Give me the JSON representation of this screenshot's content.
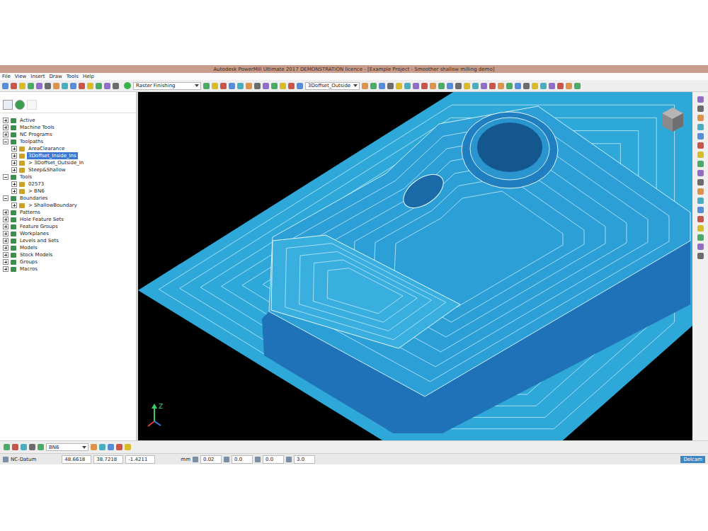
{
  "window": {
    "title": "Autodesk PowerMill Ultimate 2017 DEMONSTRATION licence - [Example Project - Smoother shallow milling demo]"
  },
  "menu": [
    "File",
    "View",
    "Insert",
    "Draw",
    "Tools",
    "Help"
  ],
  "toolbar": {
    "strategy": "Raster Finishing",
    "toolpath": "3Doffset_Outside"
  },
  "explorer": [
    {
      "label": "Active",
      "expanded": false,
      "selected": false,
      "children": []
    },
    {
      "label": "Machine Tools",
      "expanded": false,
      "selected": false,
      "children": []
    },
    {
      "label": "NC Programs",
      "expanded": false,
      "selected": false,
      "children": []
    },
    {
      "label": "Toolpaths",
      "expanded": true,
      "selected": false,
      "children": [
        {
          "label": "AreaClearance",
          "expanded": false,
          "selected": false,
          "children": []
        },
        {
          "label": "3Doffset_Inside_Ins",
          "expanded": false,
          "selected": true,
          "children": []
        },
        {
          "label": "> 3Doffset_Outside_In",
          "expanded": false,
          "selected": false,
          "children": []
        },
        {
          "label": "Steep&Shallow",
          "expanded": false,
          "selected": false,
          "children": []
        }
      ]
    },
    {
      "label": "Tools",
      "expanded": true,
      "selected": false,
      "children": [
        {
          "label": "02573",
          "expanded": false,
          "selected": false,
          "children": []
        },
        {
          "label": "> BN6",
          "expanded": false,
          "selected": false,
          "children": []
        }
      ]
    },
    {
      "label": "Boundaries",
      "expanded": true,
      "selected": false,
      "children": [
        {
          "label": "> ShallowBoundary",
          "expanded": false,
          "selected": false,
          "children": []
        }
      ]
    },
    {
      "label": "Patterns",
      "expanded": false,
      "selected": false,
      "children": []
    },
    {
      "label": "Hole Feature Sets",
      "expanded": false,
      "selected": false,
      "children": []
    },
    {
      "label": "Feature Groups",
      "expanded": false,
      "selected": false,
      "children": []
    },
    {
      "label": "Workplanes",
      "expanded": false,
      "selected": false,
      "children": []
    },
    {
      "label": "Levels and Sets",
      "expanded": false,
      "selected": false,
      "children": []
    },
    {
      "label": "Models",
      "expanded": false,
      "selected": false,
      "children": []
    },
    {
      "label": "Stock Models",
      "expanded": false,
      "selected": false,
      "children": []
    },
    {
      "label": "Groups",
      "expanded": false,
      "selected": false,
      "children": []
    },
    {
      "label": "Macros",
      "expanded": false,
      "selected": false,
      "children": []
    }
  ],
  "viewport": {
    "axis_label": "Z"
  },
  "bottom_toolbar": {
    "tool": "BN6"
  },
  "status_bar": {
    "workplane": "NC-Datum",
    "x": "48.6618",
    "y": "38.7218",
    "z": "-1.4211",
    "units": "mm",
    "tolerance": "0.02",
    "thickness": "0.0",
    "axial": "0.0",
    "stepover": "3.0",
    "brand": "Delcam"
  }
}
